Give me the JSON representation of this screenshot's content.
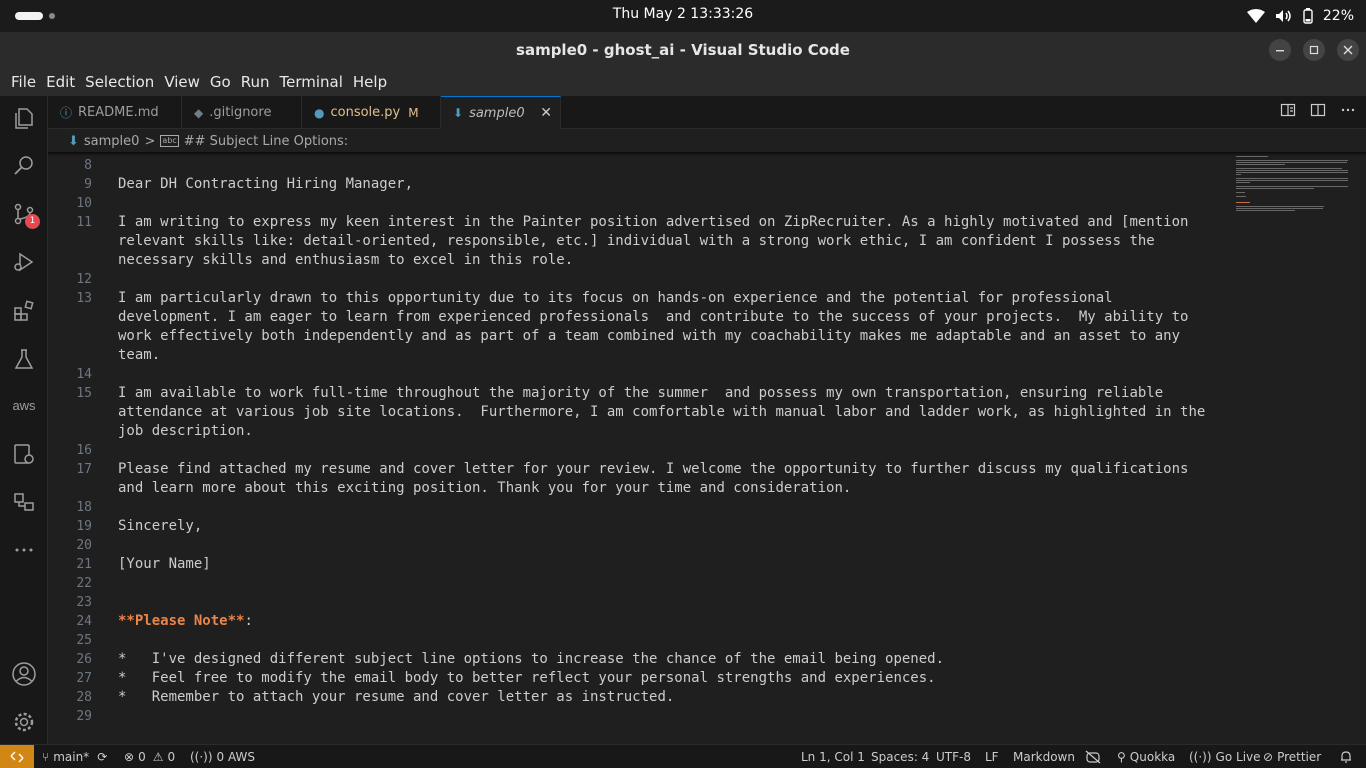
{
  "system": {
    "clock": "Thu May 2  13:33:26",
    "battery": "22%"
  },
  "window": {
    "title": "sample0 - ghost_ai - Visual Studio Code"
  },
  "menu": [
    "File",
    "Edit",
    "Selection",
    "View",
    "Go",
    "Run",
    "Terminal",
    "Help"
  ],
  "activity": {
    "source_control_badge": "1",
    "aws_label": "aws"
  },
  "tabs": [
    {
      "label": "README.md",
      "icon": "info-icon",
      "icon_color": "#519aba"
    },
    {
      "label": ".gitignore",
      "icon": "git-icon",
      "icon_color": "#6d8086"
    },
    {
      "label": "console.py",
      "modified": "M",
      "icon": "python-icon",
      "icon_color": "#519aba"
    },
    {
      "label": "sample0",
      "icon": "markdown-icon",
      "icon_color": "#519aba",
      "active": true
    }
  ],
  "breadcrumb": {
    "file": "sample0",
    "separator": ">",
    "symbol": "## Subject Line Options:"
  },
  "editor": {
    "lines": [
      {
        "n": "8",
        "text": ""
      },
      {
        "n": "9",
        "text": "Dear DH Contracting Hiring Manager,"
      },
      {
        "n": "10",
        "text": ""
      },
      {
        "n": "11",
        "text": "I am writing to express my keen interest in the Painter position advertised on ZipRecruiter. As a highly motivated and [mention"
      },
      {
        "n": "",
        "text": "relevant skills like: detail-oriented, responsible, etc.] individual with a strong work ethic, I am confident I possess the"
      },
      {
        "n": "",
        "text": "necessary skills and enthusiasm to excel in this role."
      },
      {
        "n": "12",
        "text": ""
      },
      {
        "n": "13",
        "text": "I am particularly drawn to this opportunity due to its focus on hands-on experience and the potential for professional"
      },
      {
        "n": "",
        "text": "development. I am eager to learn from experienced professionals  and contribute to the success of your projects.  My ability to"
      },
      {
        "n": "",
        "text": "work effectively both independently and as part of a team combined with my coachability makes me adaptable and an asset to any"
      },
      {
        "n": "",
        "text": "team."
      },
      {
        "n": "14",
        "text": ""
      },
      {
        "n": "15",
        "text": "I am available to work full-time throughout the majority of the summer  and possess my own transportation, ensuring reliable"
      },
      {
        "n": "",
        "text": "attendance at various job site locations.  Furthermore, I am comfortable with manual labor and ladder work, as highlighted in the"
      },
      {
        "n": "",
        "text": "job description."
      },
      {
        "n": "16",
        "text": ""
      },
      {
        "n": "17",
        "text": "Please find attached my resume and cover letter for your review. I welcome the opportunity to further discuss my qualifications"
      },
      {
        "n": "",
        "text": "and learn more about this exciting position. Thank you for your time and consideration."
      },
      {
        "n": "18",
        "text": ""
      },
      {
        "n": "19",
        "text": "Sincerely,"
      },
      {
        "n": "20",
        "text": ""
      },
      {
        "n": "21",
        "text": "[Your Name]"
      },
      {
        "n": "22",
        "text": ""
      },
      {
        "n": "23",
        "text": ""
      },
      {
        "n": "24",
        "text": "**Please Note**",
        "style": "bold-orange",
        "suffix": ":"
      },
      {
        "n": "25",
        "text": ""
      },
      {
        "n": "26",
        "text": "*   I've designed different subject line options to increase the chance of the email being opened."
      },
      {
        "n": "27",
        "text": "*   Feel free to modify the email body to better reflect your personal strengths and experiences."
      },
      {
        "n": "28",
        "text": "*   Remember to attach your resume and cover letter as instructed."
      },
      {
        "n": "29",
        "text": ""
      }
    ]
  },
  "status": {
    "branch": "main*",
    "errors": "0",
    "warnings": "0",
    "ports": "0",
    "aws": "AWS",
    "position": "Ln 1, Col 1",
    "spaces": "Spaces: 4",
    "encoding": "UTF-8",
    "eol": "LF",
    "language": "Markdown",
    "quokka": "Quokka",
    "golive": "Go Live",
    "prettier": "Prettier"
  },
  "colors": {
    "accent": "#0078d4",
    "remote": "#d18616",
    "badge": "#e5484d",
    "markdown_bold": "#e8854a"
  }
}
